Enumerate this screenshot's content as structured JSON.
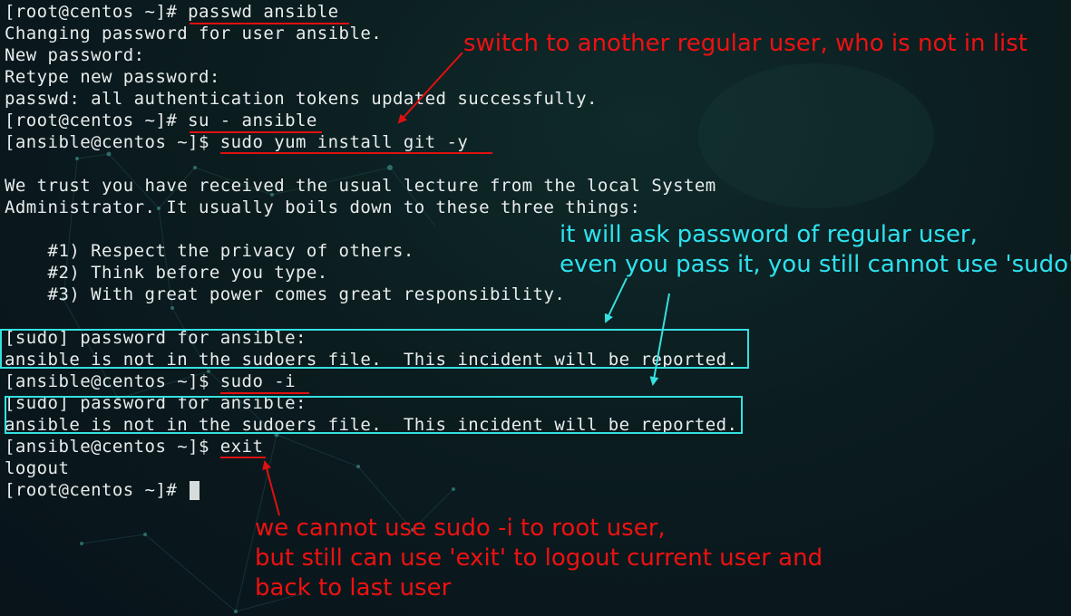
{
  "terminal": {
    "lines": [
      "[root@centos ~]# passwd ansible",
      "Changing password for user ansible.",
      "New password:",
      "Retype new password:",
      "passwd: all authentication tokens updated successfully.",
      "[root@centos ~]# su - ansible",
      "[ansible@centos ~]$ sudo yum install git -y",
      "",
      "We trust you have received the usual lecture from the local System",
      "Administrator. It usually boils down to these three things:",
      "",
      "    #1) Respect the privacy of others.",
      "    #2) Think before you type.",
      "    #3) With great power comes great responsibility.",
      "",
      "[sudo] password for ansible:",
      "ansible is not in the sudoers file.  This incident will be reported.",
      "[ansible@centos ~]$ sudo -i",
      "[sudo] password for ansible:",
      "ansible is not in the sudoers file.  This incident will be reported.",
      "[ansible@centos ~]$ exit",
      "logout",
      "[root@centos ~]# "
    ]
  },
  "annotations": {
    "switch_user": "switch to another regular user, who is not in list",
    "ask_password": [
      "it will ask password of regular user,",
      "even you pass it, you still cannot use 'sudo'"
    ],
    "exit_note": [
      "we cannot use sudo -i to root user,",
      "but still can use 'exit' to logout current user and",
      "back to last user"
    ]
  },
  "colors": {
    "terminal_text": "#e8ecec",
    "background": "#0b1c1f",
    "annotation_red": "#ee1111",
    "annotation_cyan": "#2ee2ee",
    "underline_red": "#e01010",
    "box_cyan": "#35e0e0"
  }
}
